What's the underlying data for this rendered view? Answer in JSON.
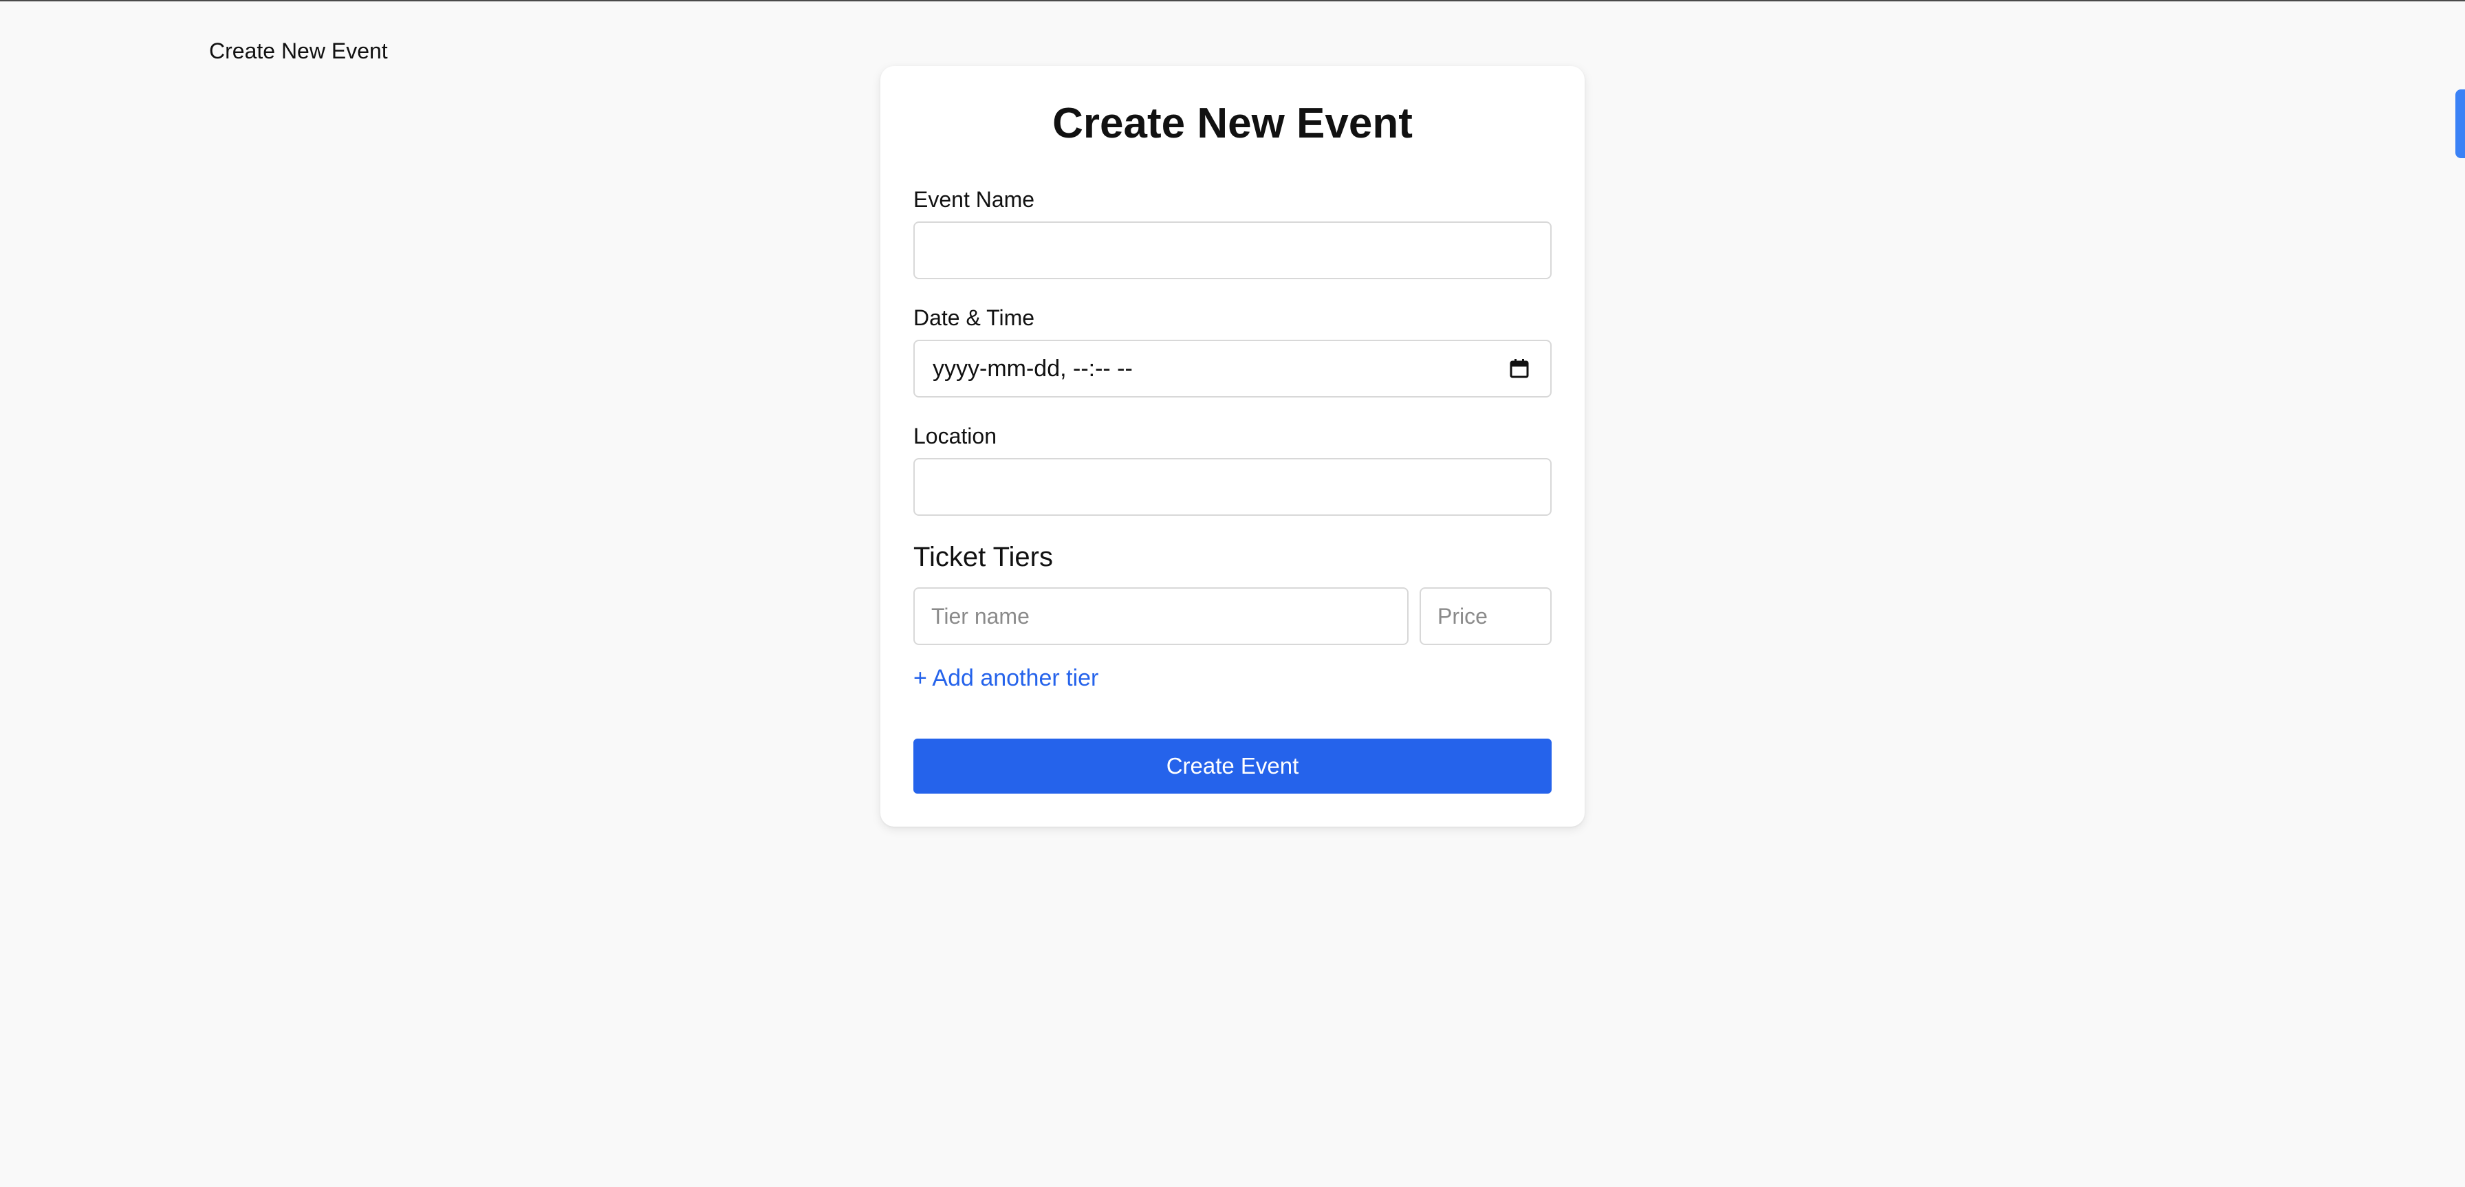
{
  "page": {
    "heading": "Create New Event"
  },
  "form": {
    "title": "Create New Event",
    "event_name": {
      "label": "Event Name",
      "value": "",
      "placeholder": ""
    },
    "date_time": {
      "label": "Date & Time",
      "display_value": "yyyy-mm-dd, --:-- --",
      "icon": "calendar-icon"
    },
    "location": {
      "label": "Location",
      "value": "",
      "placeholder": ""
    },
    "ticket_tiers": {
      "title": "Ticket Tiers",
      "tiers": [
        {
          "name_placeholder": "Tier name",
          "price_placeholder": "Price"
        }
      ],
      "add_label": "+ Add another tier"
    },
    "submit_label": "Create Event"
  },
  "colors": {
    "accent": "#2563eb",
    "background": "#f9f9f9",
    "scroll_tab": "#3b82f6"
  }
}
